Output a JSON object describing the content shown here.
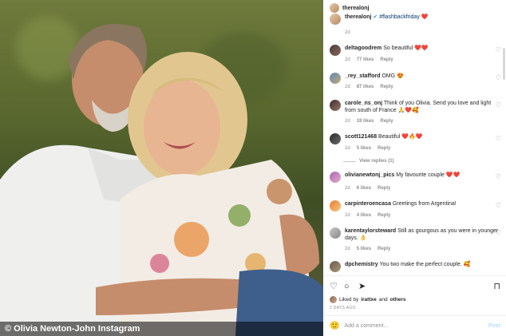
{
  "photo": {
    "caption": "© Olivia Newton-John Instagram"
  },
  "post": {
    "author": "therealonj",
    "verified": "✔",
    "caption_hashtag": "#flashbackfriday",
    "caption_emoji": "❤️",
    "age": "2d"
  },
  "comments": [
    {
      "user": "deltagoodrem",
      "text": "So beautiful ❤️❤️",
      "age": "2d",
      "likes": "77 likes",
      "reply": "Reply"
    },
    {
      "user": "_rey_stafford",
      "text": "OMG 😍",
      "age": "2d",
      "likes": "87 likes",
      "reply": "Reply"
    },
    {
      "user": "carole_ns_onj",
      "text": "Think of you Olivia. Send you love and light from south of France 🙏❤️🥰",
      "age": "2d",
      "likes": "19 likes",
      "reply": "Reply"
    },
    {
      "user": "scott121468",
      "text": "Beautiful ❤️🔥❤️",
      "age": "2d",
      "likes": "5 likes",
      "reply": "Reply",
      "view_replies": "View replies (1)"
    },
    {
      "user": "olivianewtonj_pics",
      "text": "My favourite couple ❤️❤️",
      "age": "2d",
      "likes": "6 likes",
      "reply": "Reply"
    },
    {
      "user": "carpinteroencasa",
      "text": "Greetings from Argentina!",
      "age": "2d",
      "likes": "4 likes",
      "reply": "Reply"
    },
    {
      "user": "karentaylorsteward",
      "text": "Still as gourgous as you were in younger days. 👌",
      "age": "2d",
      "likes": "5 likes",
      "reply": "Reply"
    },
    {
      "user": "dpchemistry",
      "text": "You two make the perfect couple. 🥰",
      "age": "",
      "likes": "",
      "reply": ""
    }
  ],
  "liked_by": {
    "prefix": "Liked by",
    "user": "irattxe",
    "conj": "and",
    "others": "others"
  },
  "date": "2 DAYS AGO",
  "comment_box": {
    "emoji": "🙂",
    "placeholder": "Add a comment...",
    "post": "Post"
  },
  "colors": {
    "link": "#00376b",
    "verified": "#3897f0",
    "muted": "#8e8e8e",
    "post_disabled": "#b2dffc"
  },
  "icons": [
    "heart-icon",
    "comment-icon",
    "share-icon",
    "bookmark-icon",
    "emoji-icon"
  ]
}
